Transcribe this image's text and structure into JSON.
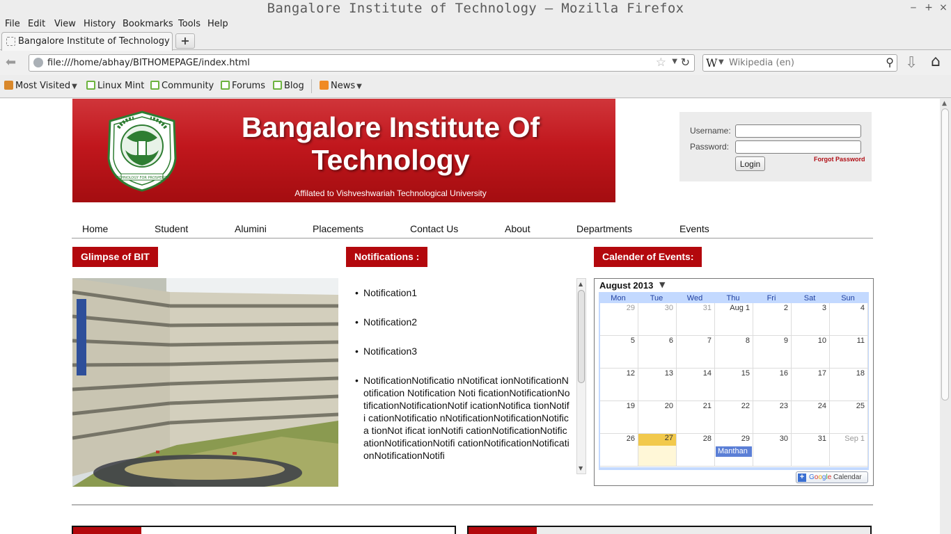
{
  "window": {
    "title": "Bangalore Institute of Technology – Mozilla Firefox"
  },
  "menubar": [
    "File",
    "Edit",
    "View",
    "History",
    "Bookmarks",
    "Tools",
    "Help"
  ],
  "tab": {
    "label": "Bangalore Institute of Technology",
    "new_tab": "+"
  },
  "urlbar": {
    "url": "file:///home/abhay/BITHOMEPAGE/index.html"
  },
  "search": {
    "engine_icon": "W",
    "placeholder": "Wikipedia (en)"
  },
  "bookmarks": [
    "Most Visited",
    "Linux Mint",
    "Community",
    "Forums",
    "Blog",
    "News"
  ],
  "page": {
    "title": "Bangalore Institute Of Technology",
    "subtitle": "Affilated to Vishveshwariah Technological University",
    "logo_motto": "TECHNOLOGY FOR PROSPERITY",
    "login": {
      "username_label": "Username:",
      "password_label": "Password:",
      "username_value": "",
      "password_value": "",
      "login_button": "Login",
      "forgot": "Forgot Password"
    },
    "nav": [
      "Home",
      "Student",
      "Alumini",
      "Placements",
      "Contact Us",
      "About",
      "Departments",
      "Events"
    ],
    "sections": {
      "glimpse": "Glimpse of BIT",
      "notifications": "Notifications :",
      "calendar": "Calender of Events:"
    },
    "notifications": [
      "Notification1",
      "Notification2",
      "Notification3",
      "NotificationNotificatio nNotificat ionNotificationNotification Notification Noti ficationNotificationNotificationNotificationNotif icationNotifica tionNotifi cationNotificatio nNotificationNotificationNotifica tionNot ificat ionNotifi cationNotificationNotificationNotificationNotifi cationNotificationNotificationNotificationNotifi"
    ],
    "calendar": {
      "month": "August 2013",
      "weekdays": [
        "Mon",
        "Tue",
        "Wed",
        "Thu",
        "Fri",
        "Sat",
        "Sun"
      ],
      "weeks": [
        [
          "29",
          "30",
          "31",
          "Aug 1",
          "2",
          "3",
          "4"
        ],
        [
          "5",
          "6",
          "7",
          "8",
          "9",
          "10",
          "11"
        ],
        [
          "12",
          "13",
          "14",
          "15",
          "16",
          "17",
          "18"
        ],
        [
          "19",
          "20",
          "21",
          "22",
          "23",
          "24",
          "25"
        ],
        [
          "26",
          "27",
          "28",
          "29",
          "30",
          "31",
          "Sep 1"
        ]
      ],
      "today": "27",
      "event": {
        "day": "29",
        "title": "Manthan"
      },
      "badge_brand": "Google",
      "badge_label": "Calendar"
    }
  },
  "colors": {
    "brand_red": "#b3080d",
    "calendar_blue": "#c3d9ff",
    "today": "#f2c94c",
    "event": "#5b7fd6"
  }
}
